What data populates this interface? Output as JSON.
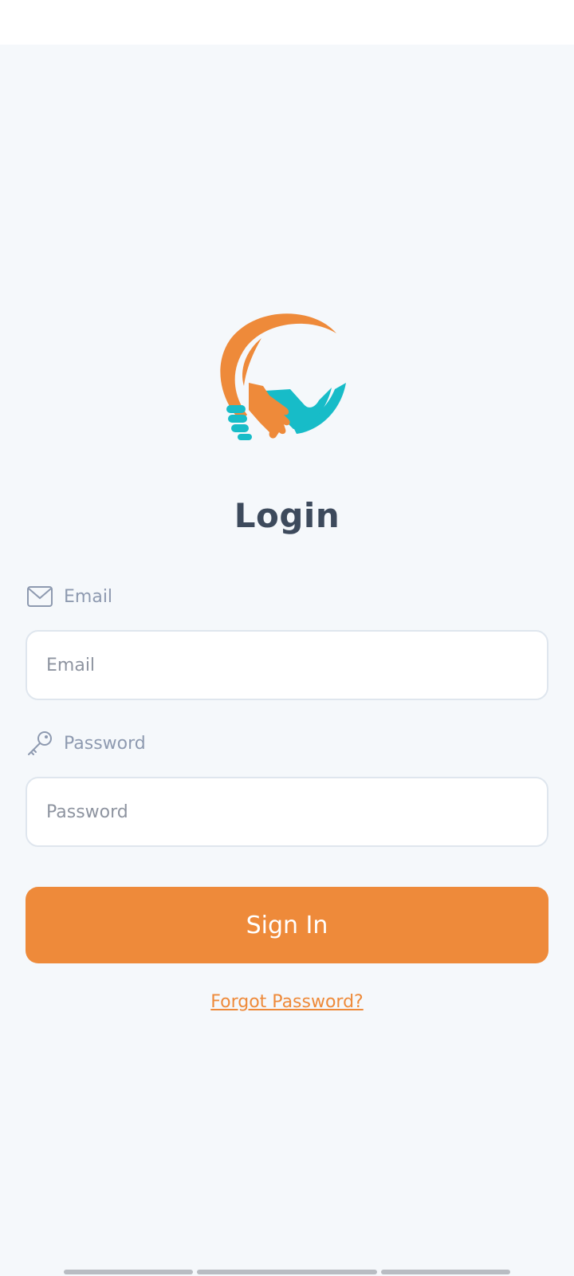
{
  "page": {
    "title": "Login"
  },
  "email": {
    "label": "Email",
    "placeholder": "Email",
    "value": ""
  },
  "password": {
    "label": "Password",
    "placeholder": "Password",
    "value": ""
  },
  "actions": {
    "signin_label": "Sign In",
    "forgot_label": "Forgot Password?"
  },
  "colors": {
    "accent": "#ee8a3a",
    "teal": "#17bcc8",
    "background": "#f5f8fb",
    "title": "#3d4a5c",
    "label": "#8e9ab0"
  },
  "icons": {
    "email": "mail-icon",
    "password": "key-icon",
    "logo": "handshake-logo"
  }
}
